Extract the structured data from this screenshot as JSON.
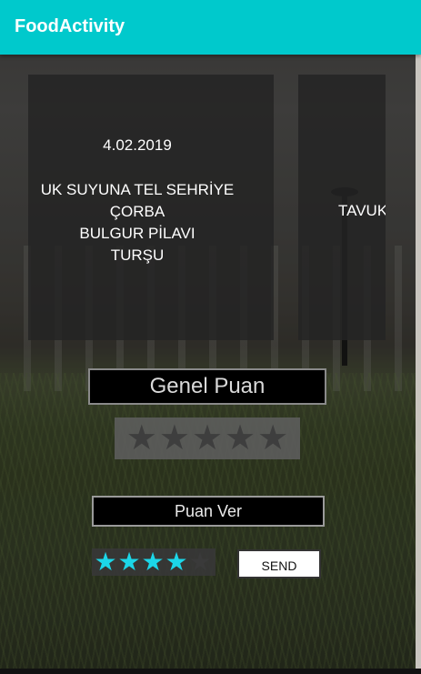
{
  "app": {
    "title": "FoodActivity"
  },
  "menu_cards": [
    {
      "date": "4.02.2019",
      "items": [
        "UK SUYUNA TEL SEHRİYE",
        "ÇORBA",
        "BULGUR PİLAVI",
        "TURŞU"
      ]
    },
    {
      "items": [
        "TAVUK"
      ]
    }
  ],
  "overall": {
    "label": "Genel Puan",
    "stars_total": 5,
    "stars_filled": 0
  },
  "user_rating": {
    "label": "Puan Ver",
    "stars_total": 5,
    "stars_filled": 4,
    "send_label": "SEND"
  },
  "colors": {
    "appbar": "#00c9cc",
    "star_active": "#1cd6e8"
  }
}
